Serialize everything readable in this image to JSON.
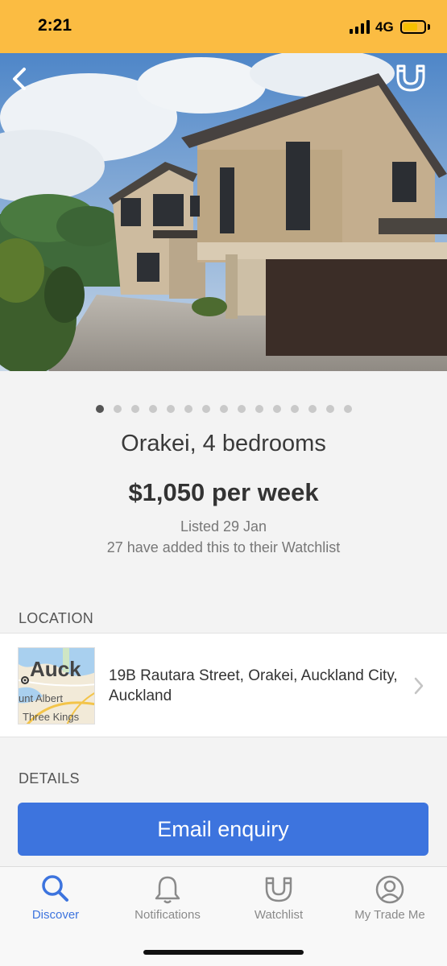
{
  "status_bar": {
    "time": "2:21",
    "network": "4G",
    "battery_level": 0.55,
    "background_color": "#fbbc42"
  },
  "gallery": {
    "image_description_icon": "house-photo",
    "total_images": 15,
    "active_index": 0
  },
  "listing": {
    "title": "Orakei, 4 bedrooms",
    "price": "$1,050 per week",
    "listed": "Listed 29 Jan",
    "watchlist_count": "27 have added this to their Watchlist"
  },
  "location": {
    "section_label": "LOCATION",
    "address": "19B Rautara Street, Orakei, Auckland City, Auckland",
    "map_labels": [
      "Auck",
      "unt Albert",
      "Three Kings"
    ]
  },
  "details": {
    "section_label": "DETAILS"
  },
  "actions": {
    "email_enquiry": "Email enquiry",
    "primary_color": "#3d74de"
  },
  "tabbar": {
    "tabs": [
      {
        "label": "Discover",
        "icon": "search-icon",
        "active": true
      },
      {
        "label": "Notifications",
        "icon": "bell-icon",
        "active": false
      },
      {
        "label": "Watchlist",
        "icon": "watchlist-icon",
        "active": false
      },
      {
        "label": "My Trade Me",
        "icon": "profile-icon",
        "active": false
      }
    ]
  }
}
